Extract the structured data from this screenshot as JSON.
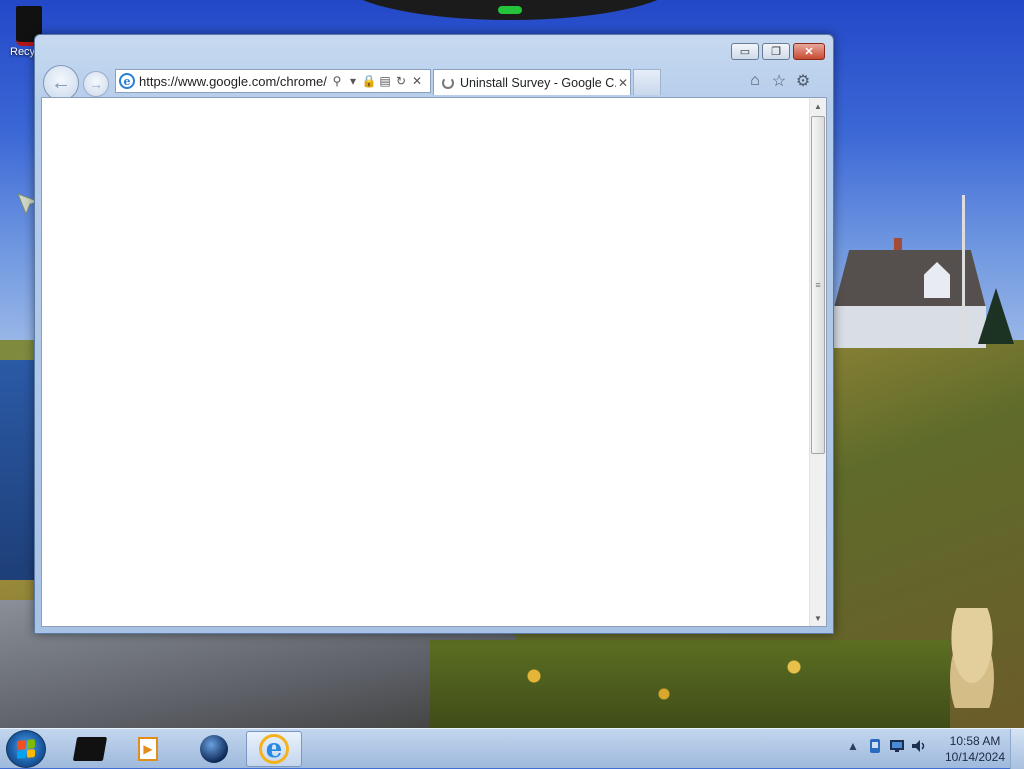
{
  "desktop": {
    "icons": [
      {
        "label": "Recy",
        "icon": "recycle-bin-icon"
      }
    ]
  },
  "window": {
    "controls": {
      "minimize": "▭",
      "maximize": "❐",
      "close": "✕"
    },
    "address": {
      "icon": "ie-icon",
      "url": "https://www.google.com/chrome/uninstall",
      "tools": {
        "search": "⚲",
        "dropdown": "▾",
        "lock": "🔒",
        "compat": "▤",
        "refresh": "↻",
        "stop": "✕"
      }
    },
    "tab": {
      "title": "Uninstall Survey - Google C...",
      "close": "✕"
    },
    "commands": {
      "home": "⌂",
      "favorites": "☆",
      "tools": "⚙"
    },
    "nav": {
      "back": "←",
      "forward": "→"
    },
    "scroll": {
      "up": "▲",
      "down": "▼",
      "grip": "≡"
    }
  },
  "taskbar": {
    "items": [
      {
        "name": "terminal",
        "icon": "terminal-icon"
      },
      {
        "name": "media-player",
        "icon": "media-player-icon",
        "glyph": "▶"
      },
      {
        "name": "globe-app",
        "icon": "globe-icon"
      },
      {
        "name": "internet-explorer",
        "icon": "ie-icon",
        "glyph": "e",
        "active": true
      }
    ],
    "tray": {
      "chevron": "▲"
    },
    "clock": {
      "time": "10:58 AM",
      "date": "10/14/2024"
    }
  },
  "colors": {
    "accent": "#2a7fd4",
    "close_button": "#c74a31",
    "taskbar": "#b3c9e6",
    "start_button": "#1c5ea8"
  }
}
